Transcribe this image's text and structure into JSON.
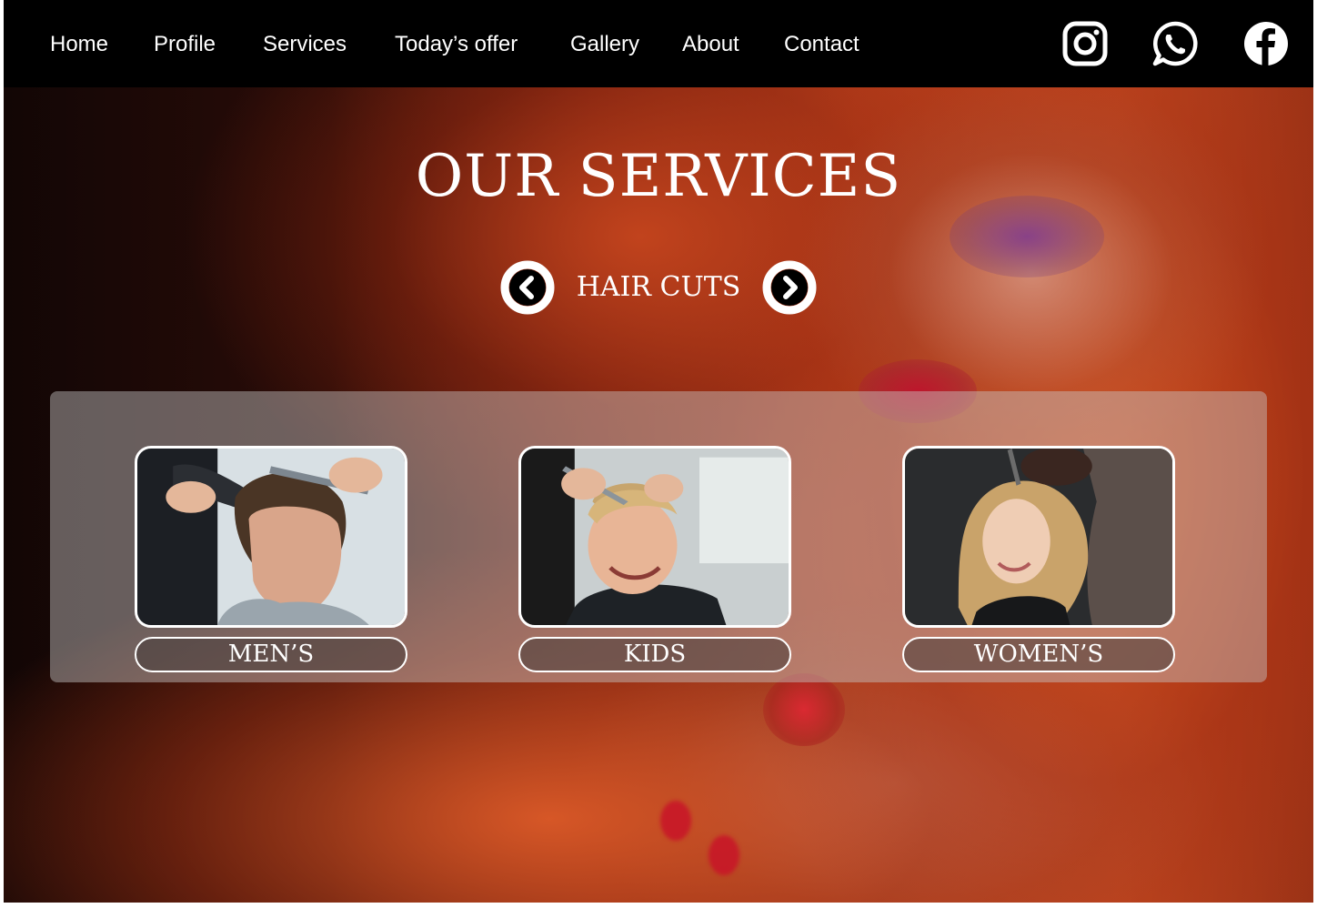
{
  "nav": {
    "items": [
      {
        "label": "Home"
      },
      {
        "label": "Profile"
      },
      {
        "label": "Services"
      },
      {
        "label": "Today’s offer"
      },
      {
        "label": "Gallery"
      },
      {
        "label": "About"
      },
      {
        "label": "Contact"
      }
    ],
    "social": [
      "instagram-icon",
      "whatsapp-icon",
      "facebook-icon"
    ]
  },
  "hero": {
    "title": "OUR SERVICES",
    "carousel": {
      "label": "HAIR CUTS",
      "prev_icon": "chevron-left-circle-icon",
      "next_icon": "chevron-right-circle-icon"
    }
  },
  "services": [
    {
      "label": "MEN’S"
    },
    {
      "label": "KIDS"
    },
    {
      "label": "WOMEN’S"
    }
  ],
  "colors": {
    "nav_background": "#000000",
    "text": "#ffffff",
    "panel": "rgba(200,200,200,0.45)",
    "accent_hair": "#c24a22"
  }
}
